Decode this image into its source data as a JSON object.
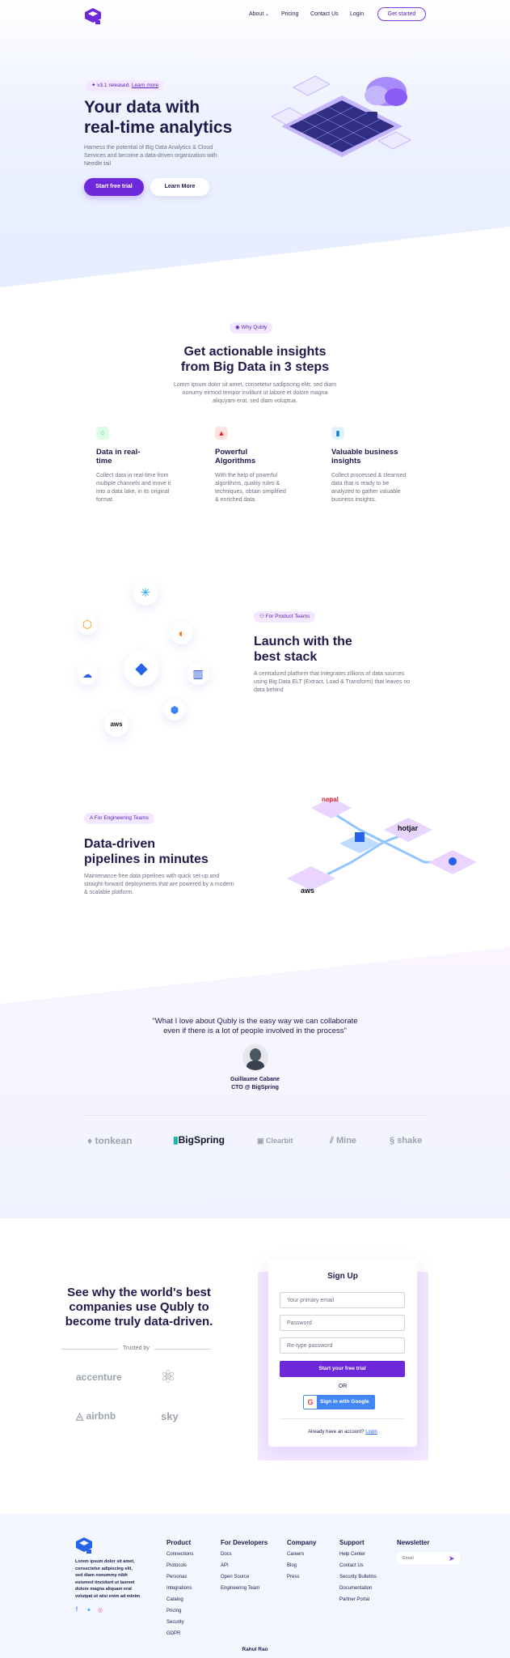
{
  "nav": {
    "items": [
      "About",
      "Pricing",
      "Contact Us",
      "Login"
    ],
    "cta": "Get started"
  },
  "hero": {
    "badge": "v3.1 released.",
    "badge_link": "Learn more",
    "title_line1": "Your data with",
    "title_line2": "real-time analytics",
    "subtitle_line1": "Harness the potential of Big Data Analytics & Cloud",
    "subtitle_line2": "Services and become a data-driven organization with",
    "subtitle_line3": "Needle tail",
    "primary_btn": "Start free trial",
    "secondary_btn": "Learn More"
  },
  "why": {
    "pill": "Why Qubly",
    "title_line1": "Get actionable insights",
    "title_line2": "from Big Data in 3 steps",
    "text_line1": "Lorem ipsum dolor sit amet, consetetur sadipscing elitr, sed diam",
    "text_line2": "nonumy eirmod tempor invidunt ut labore et dolore magna",
    "text_line3": "aliquyam erat, sed diam voluptua.",
    "features": [
      {
        "t1": "Data in real-",
        "t2": "time",
        "d1": "Collect data in real-time from",
        "d2": "multiple channels and move it",
        "d3": "into a data lake, in its original",
        "d4": "format.",
        "color": "#dcfce7",
        "fg": "#16a34a"
      },
      {
        "t1": "Powerful",
        "t2": "Algorithms",
        "d1": "With the help of powerful",
        "d2": "algorithms, quality rules &",
        "d3": "techniques, obtain simplified",
        "d4": "& enriched data.",
        "color": "#fee2e2",
        "fg": "#dc2626"
      },
      {
        "t1": "Valuable business",
        "t2": "insights",
        "d1": "Collect processed & cleansed",
        "d2": "data that is ready to be",
        "d3": "analyzed to gather valuable",
        "d4": "business insights.",
        "color": "#e0f2fe",
        "fg": "#0284c7"
      }
    ]
  },
  "stack": {
    "pill": "For Product Teams",
    "title_line1": "Launch with the",
    "title_line2": "best stack",
    "text_line1": "A centralized platform that integrates zillions of data sources",
    "text_line2": "using Big Data ELT (Extract, Load & Transform) that leaves no",
    "text_line3": "data behind",
    "aws": "aws"
  },
  "pipelines": {
    "pill": "For Engineering Teams",
    "title_line1": "Data-driven",
    "title_line2": "pipelines in minutes",
    "text_line1": "Maintenance-free data pipelines with quick set-up and",
    "text_line2": "straight-forward deployments that are powered by a modern",
    "text_line3": "& scalable platform.",
    "tile_aws": "aws",
    "tile_hotjar": "hotjar",
    "tile_nepal": "nepal"
  },
  "testimonial": {
    "quote_line1": "\"What I love about Qubly is the easy way we can collaborate",
    "quote_line2": "even if there is a lot of people involved in the process\"",
    "name": "Guillaume Cabane",
    "role": "CTO @ BigSpring",
    "clients": [
      "tonkean",
      "BigSpring",
      "Clearbit",
      "Mine",
      "shake"
    ]
  },
  "signup": {
    "title_line1": "See why the world's best",
    "title_line2": "companies use Qubly to",
    "title_line3": "become truly data-driven.",
    "trusted": "Trusted by",
    "logos": [
      "accenture",
      "airbnb",
      "sky"
    ],
    "form": {
      "title": "Sign Up",
      "email": "Your primary email",
      "password": "Password",
      "repassword": "Re-type password",
      "submit": "Start your free trial",
      "or": "OR",
      "google": "Sign in with Google",
      "have_account": "Already have an account?",
      "login": "Login"
    }
  },
  "footer": {
    "about_line1": "Lorem ipsum dolor sit amet,",
    "about_line2": "consectetur adipiscing elit,",
    "about_line3": "sed diam nonummy nibh",
    "about_line4": "euismod tincidunt ut laoreet",
    "about_line5": "dolore magna aliquam erat",
    "about_line6": "volutpat ut wisi enim ad minim",
    "cols": [
      {
        "title": "Product",
        "links": [
          "Connections",
          "Protocols",
          "Personas",
          "Integrations",
          "Catalog",
          "Pricing",
          "Security",
          "GDPR"
        ]
      },
      {
        "title": "For Developers",
        "links": [
          "Docs",
          "API",
          "Open Source",
          "Engineering Team"
        ]
      },
      {
        "title": "Company",
        "links": [
          "Careers",
          "Blog",
          "Press"
        ]
      },
      {
        "title": "Support",
        "links": [
          "Help Center",
          "Contact Us",
          "Security Bulletins",
          "Documentation",
          "Partner Portal"
        ]
      }
    ],
    "newsletter": "Newsletter",
    "newsletter_placeholder": "Email",
    "credit": "Rahul Rao"
  },
  "colors": {
    "primary": "#6d28d9",
    "accent": "#7c3aed",
    "dark": "#1e1b4b"
  }
}
